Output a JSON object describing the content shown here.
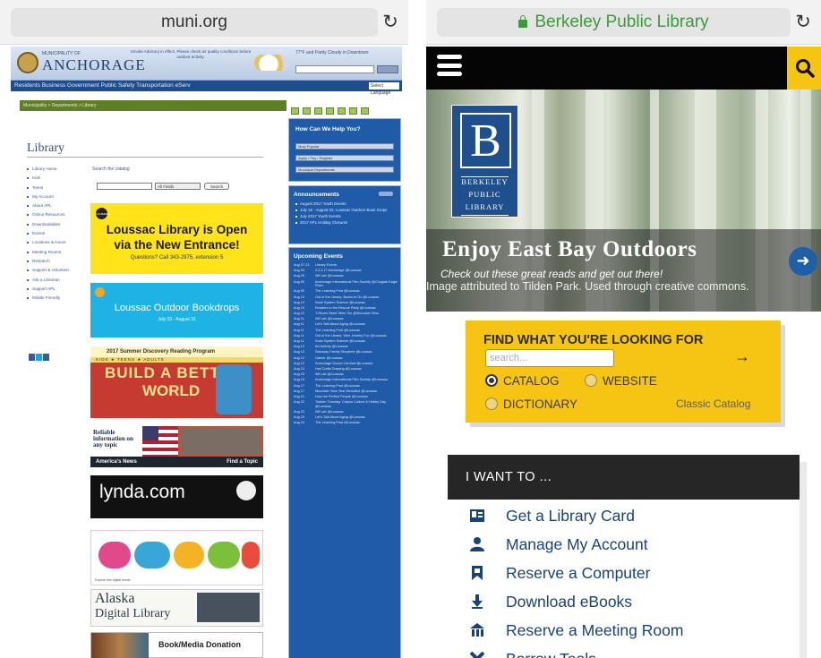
{
  "left": {
    "url": "muni.org",
    "header": {
      "municipality": "MUNICIPALITY OF",
      "logo": "ANCHORAGE",
      "weather": "77°F and Partly Cloudy in Downtown",
      "search_button": "Search",
      "language": "Select Language"
    },
    "nav": "Residents   Business   Government   Public Safety   Transportation   eServ",
    "breadcrumb": "Municipality > Departments > Library",
    "page_title": "Library",
    "sidebar": [
      "Library Home",
      "Kids",
      "Teens",
      "My Account",
      "About APL",
      "Online Resources",
      "Downloadables",
      "Events",
      "Locations & Hours",
      "Meeting Rooms",
      "Research",
      "Support & Volunteer",
      "Ask a Librarian",
      "Support APL",
      "Mobile Friendly"
    ],
    "catalog": {
      "label": "Search the catalog",
      "select": "All Fields",
      "button": "Search"
    },
    "banner_open": {
      "badge": "Loussac",
      "line1": "Loussac Library is Open",
      "line2": "via the New Entrance!",
      "line3": "Questions? Call 343-2975, extension 5"
    },
    "banner_bookdrops": {
      "title": "Loussac Outdoor Bookdrops",
      "subtitle": "July 23 - August 31"
    },
    "summer": {
      "top": "2017 Summer Discovery Reading Program",
      "tabs": "KIDS   ★   TEENS   ★   ADULTS",
      "line1": "BUILD A BETTER",
      "line2": "WORLD"
    },
    "reliable": {
      "text": "Reliable information on any topic",
      "left": "America's News",
      "right": "Find a Topic"
    },
    "lynda": {
      "logo": "lynda.com"
    },
    "noodle": {
      "sub": "Explore free digital media"
    },
    "alaska": {
      "line1": "Alaska",
      "line2": "Digital Library"
    },
    "donation": {
      "title": "Book/Media Donation"
    },
    "help": {
      "title": "How Can We Help You?",
      "selects": [
        "Most Popular",
        "Apply / Pay / Register",
        "Municipal Departments"
      ]
    },
    "announcements": {
      "title": "Announcements",
      "items": [
        "August 2017 Youth Events",
        "July 15 - August 31: Loussac Outdoor Book Drops",
        "July 2017 Youth Events",
        "2017 APL Holiday Closures"
      ]
    },
    "upcoming": {
      "title": "Upcoming Events",
      "rows": [
        {
          "d": "Aug 07-13",
          "e": "Library Events"
        },
        {
          "d": "Aug 09",
          "e": "3-2-1-IT Anchorage @Loussac"
        },
        {
          "d": "Aug 09",
          "e": "Wii Lab @Loussac"
        },
        {
          "d": "Aug 09",
          "e": "Anchorage International Film Society @Chugiak-Eagle River"
        },
        {
          "d": "Aug 09",
          "e": "The Learning Post @Loussac"
        },
        {
          "d": "Aug 10",
          "e": "Out of the Library: Books to Go @Loussac"
        },
        {
          "d": "Aug 10",
          "e": "Solar System Science @Loussac"
        },
        {
          "d": "Aug 10",
          "e": "Readers to the Rescue Party @Loussac"
        },
        {
          "d": "Aug 10",
          "e": "T-Rexes Need Tales Too @Mountain View"
        },
        {
          "d": "Aug 11",
          "e": "Wii Lab @Loussac"
        },
        {
          "d": "Aug 11",
          "e": "Let's Talk About Aging @Loussac"
        },
        {
          "d": "Aug 11",
          "e": "The Learning Post @Loussac"
        },
        {
          "d": "Aug 11",
          "e": "Out of the Library: Wire Jewelry Fun @Loussac"
        },
        {
          "d": "Aug 11",
          "e": "Solar System Science @Loussac"
        },
        {
          "d": "Aug 12",
          "e": "Art Activity @Loussac"
        },
        {
          "d": "Aug 12",
          "e": "Saturday Family Storytime @Loussac"
        },
        {
          "d": "Aug 12",
          "e": "Gamer @Loussac"
        },
        {
          "d": "Aug 12",
          "e": "Anchorage Sound Carnival @Loussac"
        },
        {
          "d": "Aug 14",
          "e": "Hall Crafts Drawing @Loussac"
        },
        {
          "d": "Aug 15",
          "e": "Wii Lab @Loussac"
        },
        {
          "d": "Aug 15",
          "e": "Anchorage International Film Society @Loussac"
        },
        {
          "d": "Aug 17",
          "e": "The Learning Post @Loussac"
        },
        {
          "d": "Aug 17",
          "e": "Mountain View Year Revisited @Loussac"
        },
        {
          "d": "Aug 21",
          "e": "How the Perfect People @Loussac"
        },
        {
          "d": "Aug 22",
          "e": "Toddler Tuesday: Crayon Culture & Hobby Day @Loussac"
        },
        {
          "d": "Aug 23",
          "e": "Wii Lab @Loussac"
        },
        {
          "d": "Aug 23",
          "e": "Let's Talk About Aging @Loussac"
        },
        {
          "d": "Aug 24",
          "e": "The Learning Post @Loussac"
        }
      ]
    }
  },
  "right": {
    "url": "Berkeley Public Library",
    "logo": {
      "letter": "B",
      "line1": "BERKELEY",
      "line2": "PUBLIC",
      "line3": "LIBRARY"
    },
    "hero": {
      "title": "Enjoy East Bay Outdoors",
      "subtitle": "Check out these great reads and get out there!",
      "caption": "Image attributed to Tilden Park. Used through creative commons."
    },
    "find": {
      "title": "FIND WHAT YOU'RE LOOKING FOR",
      "placeholder": "search...",
      "options": [
        "CATALOG",
        "WEBSITE",
        "DICTIONARY"
      ],
      "classic": "Classic Catalog"
    },
    "want": {
      "title": "I WANT TO ...",
      "items": [
        "Get a Library Card",
        "Manage My Account",
        "Reserve a Computer",
        "Download eBooks",
        "Reserve a Meeting Room",
        "Borrow Tools"
      ]
    },
    "colors": {
      "accent": "#f6c514",
      "link": "#17437b",
      "nav": "#050505"
    }
  }
}
